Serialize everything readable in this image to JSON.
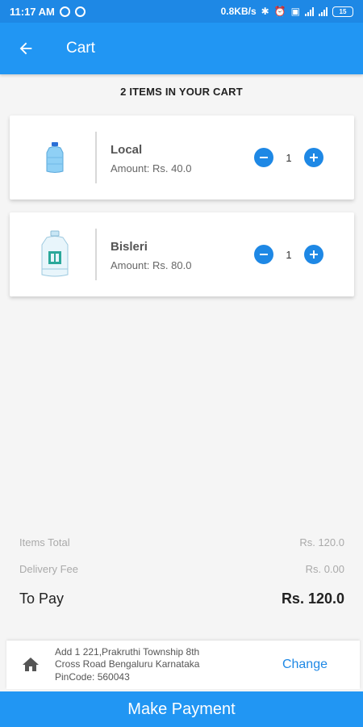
{
  "status_bar": {
    "time": "11:17 AM",
    "net_speed": "0.8KB/s",
    "battery": "15"
  },
  "header": {
    "title": "Cart",
    "back_icon": "arrow-left-icon"
  },
  "cart_count_label": "2 ITEMS IN YOUR CART",
  "items": [
    {
      "name": "Local",
      "amount": "Amount: Rs. 40.0",
      "quantity": "1",
      "image_icon": "small-water-bottle-icon"
    },
    {
      "name": "Bisleri",
      "amount": "Amount: Rs. 80.0",
      "quantity": "1",
      "image_icon": "water-jar-icon"
    }
  ],
  "summary": {
    "items_total_label": "Items Total",
    "items_total_value": "Rs. 120.0",
    "delivery_fee_label": "Delivery Fee",
    "delivery_fee_value": "Rs. 0.00",
    "to_pay_label": "To Pay",
    "to_pay_value": "Rs. 120.0"
  },
  "address": {
    "line1": "Add 1 221,Prakruthi Township 8th",
    "line2": "Cross Road Bengaluru Karnataka",
    "line3": "PinCode: 560043",
    "change_label": "Change",
    "home_icon": "home-icon"
  },
  "make_payment_label": "Make Payment",
  "colors": {
    "primary": "#2196f3",
    "primary_dark": "#1e88e5"
  }
}
